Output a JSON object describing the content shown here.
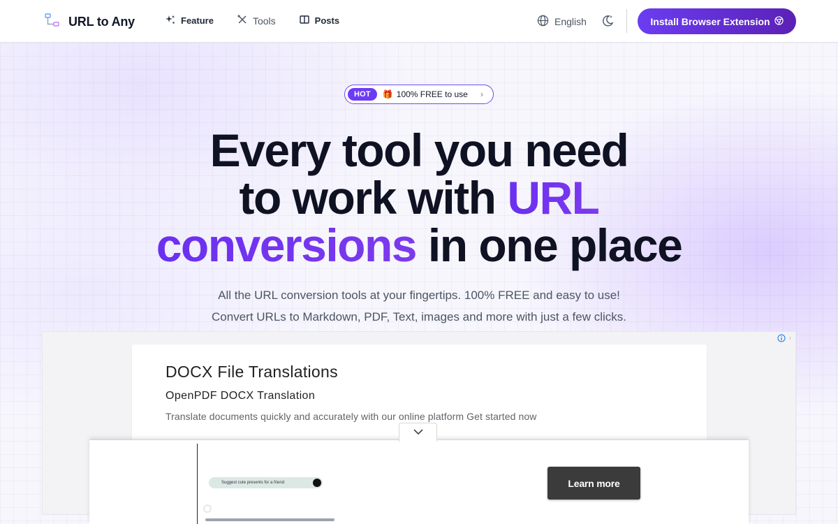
{
  "header": {
    "logo_text": "URL to Any",
    "nav": [
      {
        "label": "Feature",
        "icon": "sparkles-icon"
      },
      {
        "label": "Tools",
        "icon": "tools-icon"
      },
      {
        "label": "Posts",
        "icon": "book-icon"
      }
    ],
    "language": "English",
    "install_button": "Install Browser Extension"
  },
  "hero": {
    "badge_hot": "HOT",
    "badge_text": "100% FREE to use",
    "badge_gift": "🎁",
    "headline_line1": "Every tool you need",
    "headline_line2_plain": "to work with ",
    "headline_line2_accent": "URL",
    "headline_line3_accent": "conversions",
    "headline_line3_plain": " in one place",
    "subtitle_line1": "All the URL conversion tools at your fingertips. 100% FREE and easy to use!",
    "subtitle_line2": "Convert URLs to Markdown, PDF, Text, images and more with just a few clicks."
  },
  "ad": {
    "title": "DOCX File Translations",
    "subtitle": "OpenPDF DOCX Translation",
    "description": "Translate documents quickly and accurately with our online platform Get started now"
  },
  "anchor_ad": {
    "pill_text": "Suggest cute presents for a friend",
    "cta": "Learn more"
  },
  "colors": {
    "accent": "#6b2ff0",
    "install_button": "#5b21b6",
    "learn_more_button": "#3b3b3b"
  }
}
